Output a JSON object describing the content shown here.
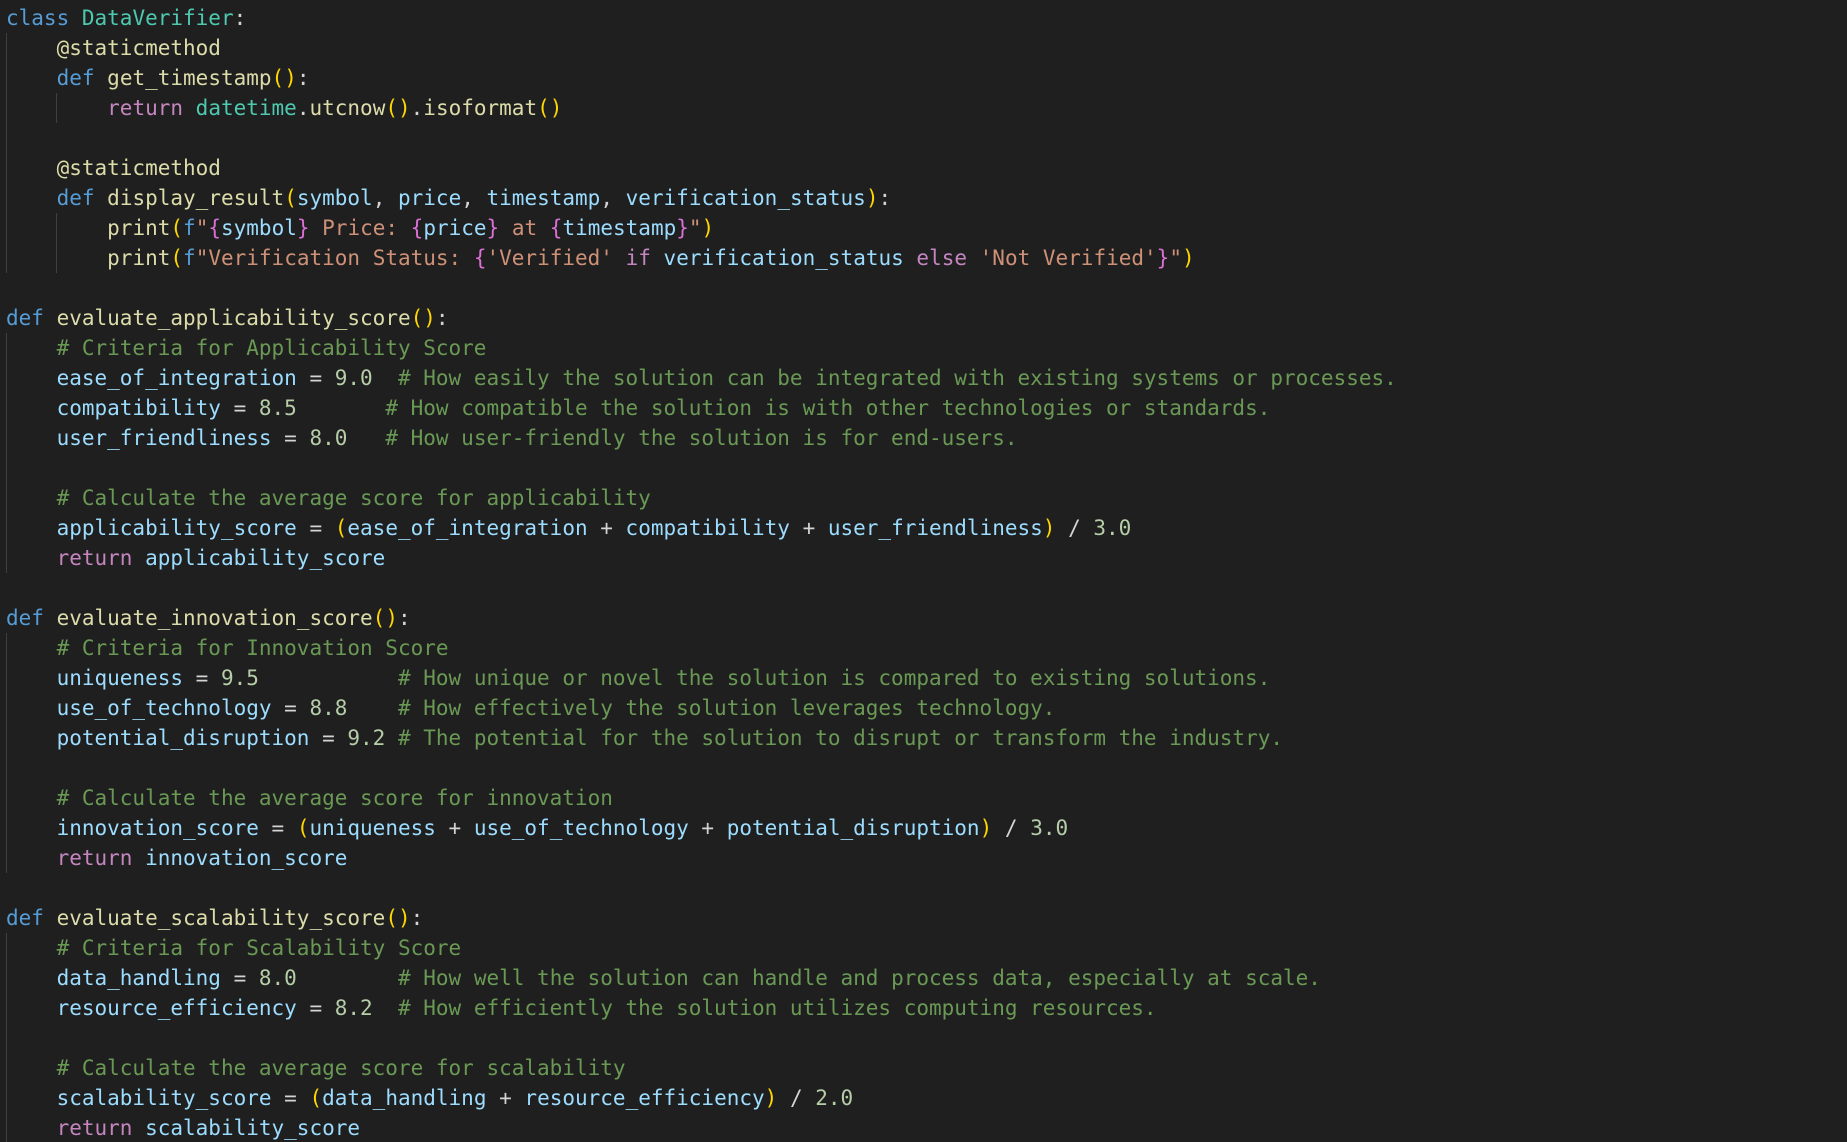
{
  "editor": {
    "lines": [
      [
        {
          "t": "class",
          "c": "kw"
        },
        {
          "t": " "
        },
        {
          "t": "DataVerifier",
          "c": "cls"
        },
        {
          "t": ":",
          "c": "op"
        }
      ],
      [
        {
          "t": "    "
        },
        {
          "t": "@staticmethod",
          "c": "dec"
        }
      ],
      [
        {
          "t": "    "
        },
        {
          "t": "def",
          "c": "kw"
        },
        {
          "t": " "
        },
        {
          "t": "get_timestamp",
          "c": "fn"
        },
        {
          "t": "()",
          "c": "p1"
        },
        {
          "t": ":",
          "c": "op"
        }
      ],
      [
        {
          "t": "        "
        },
        {
          "t": "return",
          "c": "ctl"
        },
        {
          "t": " "
        },
        {
          "t": "datetime",
          "c": "cls"
        },
        {
          "t": ".",
          "c": "op"
        },
        {
          "t": "utcnow",
          "c": "fn"
        },
        {
          "t": "()",
          "c": "p1"
        },
        {
          "t": ".",
          "c": "op"
        },
        {
          "t": "isoformat",
          "c": "fn"
        },
        {
          "t": "()",
          "c": "p1"
        }
      ],
      [],
      [
        {
          "t": "    "
        },
        {
          "t": "@staticmethod",
          "c": "dec"
        }
      ],
      [
        {
          "t": "    "
        },
        {
          "t": "def",
          "c": "kw"
        },
        {
          "t": " "
        },
        {
          "t": "display_result",
          "c": "fn"
        },
        {
          "t": "(",
          "c": "p1"
        },
        {
          "t": "symbol",
          "c": "var"
        },
        {
          "t": ", ",
          "c": "op"
        },
        {
          "t": "price",
          "c": "var"
        },
        {
          "t": ", ",
          "c": "op"
        },
        {
          "t": "timestamp",
          "c": "var"
        },
        {
          "t": ", ",
          "c": "op"
        },
        {
          "t": "verification_status",
          "c": "var"
        },
        {
          "t": ")",
          "c": "p1"
        },
        {
          "t": ":",
          "c": "op"
        }
      ],
      [
        {
          "t": "        "
        },
        {
          "t": "print",
          "c": "fn"
        },
        {
          "t": "(",
          "c": "p1"
        },
        {
          "t": "f",
          "c": "kw"
        },
        {
          "t": "\"",
          "c": "str"
        },
        {
          "t": "{",
          "c": "p2"
        },
        {
          "t": "symbol",
          "c": "var"
        },
        {
          "t": "}",
          "c": "p2"
        },
        {
          "t": " Price: ",
          "c": "str"
        },
        {
          "t": "{",
          "c": "p2"
        },
        {
          "t": "price",
          "c": "var"
        },
        {
          "t": "}",
          "c": "p2"
        },
        {
          "t": " at ",
          "c": "str"
        },
        {
          "t": "{",
          "c": "p2"
        },
        {
          "t": "timestamp",
          "c": "var"
        },
        {
          "t": "}",
          "c": "p2"
        },
        {
          "t": "\"",
          "c": "str"
        },
        {
          "t": ")",
          "c": "p1"
        }
      ],
      [
        {
          "t": "        "
        },
        {
          "t": "print",
          "c": "fn"
        },
        {
          "t": "(",
          "c": "p1"
        },
        {
          "t": "f",
          "c": "kw"
        },
        {
          "t": "\"Verification Status: ",
          "c": "str"
        },
        {
          "t": "{",
          "c": "p2"
        },
        {
          "t": "'Verified'",
          "c": "str"
        },
        {
          "t": " "
        },
        {
          "t": "if",
          "c": "ctl"
        },
        {
          "t": " "
        },
        {
          "t": "verification_status",
          "c": "var"
        },
        {
          "t": " "
        },
        {
          "t": "else",
          "c": "ctl"
        },
        {
          "t": " "
        },
        {
          "t": "'Not Verified'",
          "c": "str"
        },
        {
          "t": "}",
          "c": "p2"
        },
        {
          "t": "\"",
          "c": "str"
        },
        {
          "t": ")",
          "c": "p1"
        }
      ],
      [],
      [
        {
          "t": "def",
          "c": "kw"
        },
        {
          "t": " "
        },
        {
          "t": "evaluate_applicability_score",
          "c": "fn"
        },
        {
          "t": "()",
          "c": "p1"
        },
        {
          "t": ":",
          "c": "op"
        }
      ],
      [
        {
          "t": "    "
        },
        {
          "t": "# Criteria for Applicability Score",
          "c": "cmt"
        }
      ],
      [
        {
          "t": "    "
        },
        {
          "t": "ease_of_integration",
          "c": "var"
        },
        {
          "t": " = ",
          "c": "op"
        },
        {
          "t": "9.0",
          "c": "num"
        },
        {
          "t": "  "
        },
        {
          "t": "# How easily the solution can be integrated with existing systems or processes.",
          "c": "cmt"
        }
      ],
      [
        {
          "t": "    "
        },
        {
          "t": "compatibility",
          "c": "var"
        },
        {
          "t": " = ",
          "c": "op"
        },
        {
          "t": "8.5",
          "c": "num"
        },
        {
          "t": "       "
        },
        {
          "t": "# How compatible the solution is with other technologies or standards.",
          "c": "cmt"
        }
      ],
      [
        {
          "t": "    "
        },
        {
          "t": "user_friendliness",
          "c": "var"
        },
        {
          "t": " = ",
          "c": "op"
        },
        {
          "t": "8.0",
          "c": "num"
        },
        {
          "t": "   "
        },
        {
          "t": "# How user-friendly the solution is for end-users.",
          "c": "cmt"
        }
      ],
      [],
      [
        {
          "t": "    "
        },
        {
          "t": "# Calculate the average score for applicability",
          "c": "cmt"
        }
      ],
      [
        {
          "t": "    "
        },
        {
          "t": "applicability_score",
          "c": "var"
        },
        {
          "t": " = ",
          "c": "op"
        },
        {
          "t": "(",
          "c": "p1"
        },
        {
          "t": "ease_of_integration",
          "c": "var"
        },
        {
          "t": " + ",
          "c": "op"
        },
        {
          "t": "compatibility",
          "c": "var"
        },
        {
          "t": " + ",
          "c": "op"
        },
        {
          "t": "user_friendliness",
          "c": "var"
        },
        {
          "t": ")",
          "c": "p1"
        },
        {
          "t": " / ",
          "c": "op"
        },
        {
          "t": "3.0",
          "c": "num"
        }
      ],
      [
        {
          "t": "    "
        },
        {
          "t": "return",
          "c": "ctl"
        },
        {
          "t": " "
        },
        {
          "t": "applicability_score",
          "c": "var"
        }
      ],
      [],
      [
        {
          "t": "def",
          "c": "kw"
        },
        {
          "t": " "
        },
        {
          "t": "evaluate_innovation_score",
          "c": "fn"
        },
        {
          "t": "()",
          "c": "p1"
        },
        {
          "t": ":",
          "c": "op"
        }
      ],
      [
        {
          "t": "    "
        },
        {
          "t": "# Criteria for Innovation Score",
          "c": "cmt"
        }
      ],
      [
        {
          "t": "    "
        },
        {
          "t": "uniqueness",
          "c": "var"
        },
        {
          "t": " = ",
          "c": "op"
        },
        {
          "t": "9.5",
          "c": "num"
        },
        {
          "t": "           "
        },
        {
          "t": "# How unique or novel the solution is compared to existing solutions.",
          "c": "cmt"
        }
      ],
      [
        {
          "t": "    "
        },
        {
          "t": "use_of_technology",
          "c": "var"
        },
        {
          "t": " = ",
          "c": "op"
        },
        {
          "t": "8.8",
          "c": "num"
        },
        {
          "t": "    "
        },
        {
          "t": "# How effectively the solution leverages technology.",
          "c": "cmt"
        }
      ],
      [
        {
          "t": "    "
        },
        {
          "t": "potential_disruption",
          "c": "var"
        },
        {
          "t": " = ",
          "c": "op"
        },
        {
          "t": "9.2",
          "c": "num"
        },
        {
          "t": " "
        },
        {
          "t": "# The potential for the solution to disrupt or transform the industry.",
          "c": "cmt"
        }
      ],
      [],
      [
        {
          "t": "    "
        },
        {
          "t": "# Calculate the average score for innovation",
          "c": "cmt"
        }
      ],
      [
        {
          "t": "    "
        },
        {
          "t": "innovation_score",
          "c": "var"
        },
        {
          "t": " = ",
          "c": "op"
        },
        {
          "t": "(",
          "c": "p1"
        },
        {
          "t": "uniqueness",
          "c": "var"
        },
        {
          "t": " + ",
          "c": "op"
        },
        {
          "t": "use_of_technology",
          "c": "var"
        },
        {
          "t": " + ",
          "c": "op"
        },
        {
          "t": "potential_disruption",
          "c": "var"
        },
        {
          "t": ")",
          "c": "p1"
        },
        {
          "t": " / ",
          "c": "op"
        },
        {
          "t": "3.0",
          "c": "num"
        }
      ],
      [
        {
          "t": "    "
        },
        {
          "t": "return",
          "c": "ctl"
        },
        {
          "t": " "
        },
        {
          "t": "innovation_score",
          "c": "var"
        }
      ],
      [],
      [
        {
          "t": "def",
          "c": "kw"
        },
        {
          "t": " "
        },
        {
          "t": "evaluate_scalability_score",
          "c": "fn"
        },
        {
          "t": "()",
          "c": "p1"
        },
        {
          "t": ":",
          "c": "op"
        }
      ],
      [
        {
          "t": "    "
        },
        {
          "t": "# Criteria for Scalability Score",
          "c": "cmt"
        }
      ],
      [
        {
          "t": "    "
        },
        {
          "t": "data_handling",
          "c": "var"
        },
        {
          "t": " = ",
          "c": "op"
        },
        {
          "t": "8.0",
          "c": "num"
        },
        {
          "t": "        "
        },
        {
          "t": "# How well the solution can handle and process data, especially at scale.",
          "c": "cmt"
        }
      ],
      [
        {
          "t": "    "
        },
        {
          "t": "resource_efficiency",
          "c": "var"
        },
        {
          "t": " = ",
          "c": "op"
        },
        {
          "t": "8.2",
          "c": "num"
        },
        {
          "t": "  "
        },
        {
          "t": "# How efficiently the solution utilizes computing resources.",
          "c": "cmt"
        }
      ],
      [],
      [
        {
          "t": "    "
        },
        {
          "t": "# Calculate the average score for scalability",
          "c": "cmt"
        }
      ],
      [
        {
          "t": "    "
        },
        {
          "t": "scalability_score",
          "c": "var"
        },
        {
          "t": " = ",
          "c": "op"
        },
        {
          "t": "(",
          "c": "p1"
        },
        {
          "t": "data_handling",
          "c": "var"
        },
        {
          "t": " + ",
          "c": "op"
        },
        {
          "t": "resource_efficiency",
          "c": "var"
        },
        {
          "t": ")",
          "c": "p1"
        },
        {
          "t": " / ",
          "c": "op"
        },
        {
          "t": "2.0",
          "c": "num"
        }
      ],
      [
        {
          "t": "    "
        },
        {
          "t": "return",
          "c": "ctl"
        },
        {
          "t": " "
        },
        {
          "t": "scalability_score",
          "c": "var"
        }
      ]
    ]
  }
}
